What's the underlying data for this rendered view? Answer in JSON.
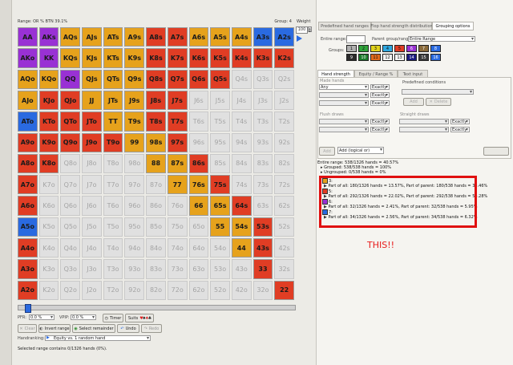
{
  "range_header": {
    "left": "Range: OR % BTN 39.1%",
    "group": "Group: 4",
    "weight_label": "Weight",
    "weight_value": "100"
  },
  "grid": {
    "rows": [
      [
        [
          "AA",
          "p"
        ],
        [
          "AKs",
          "p"
        ],
        [
          "AQs",
          "o"
        ],
        [
          "AJs",
          "o"
        ],
        [
          "ATs",
          "o"
        ],
        [
          "A9s",
          "o"
        ],
        [
          "A8s",
          "r"
        ],
        [
          "A7s",
          "r"
        ],
        [
          "A6s",
          "o"
        ],
        [
          "A5s",
          "o"
        ],
        [
          "A4s",
          "o"
        ],
        [
          "A3s",
          "b"
        ],
        [
          "A2s",
          "b"
        ]
      ],
      [
        [
          "AKo",
          "p"
        ],
        [
          "KK",
          "p"
        ],
        [
          "KQs",
          "o"
        ],
        [
          "KJs",
          "o"
        ],
        [
          "KTs",
          "o"
        ],
        [
          "K9s",
          "o"
        ],
        [
          "K8s",
          "r"
        ],
        [
          "K7s",
          "r"
        ],
        [
          "K6s",
          "r"
        ],
        [
          "K5s",
          "r"
        ],
        [
          "K4s",
          "r"
        ],
        [
          "K3s",
          "r"
        ],
        [
          "K2s",
          "r"
        ]
      ],
      [
        [
          "AQo",
          "o"
        ],
        [
          "KQo",
          "o"
        ],
        [
          "QQ",
          "p"
        ],
        [
          "QJs",
          "o"
        ],
        [
          "QTs",
          "o"
        ],
        [
          "Q9s",
          "o"
        ],
        [
          "Q8s",
          "r"
        ],
        [
          "Q7s",
          "r"
        ],
        [
          "Q6s",
          "r"
        ],
        [
          "Q5s",
          "r"
        ],
        [
          "Q4s",
          "g"
        ],
        [
          "Q3s",
          "g"
        ],
        [
          "Q2s",
          "g"
        ]
      ],
      [
        [
          "AJo",
          "o"
        ],
        [
          "KJo",
          "r"
        ],
        [
          "QJo",
          "r"
        ],
        [
          "JJ",
          "o"
        ],
        [
          "JTs",
          "o"
        ],
        [
          "J9s",
          "o"
        ],
        [
          "J8s",
          "r"
        ],
        [
          "J7s",
          "r"
        ],
        [
          "J6s",
          "g"
        ],
        [
          "J5s",
          "g"
        ],
        [
          "J4s",
          "g"
        ],
        [
          "J3s",
          "g"
        ],
        [
          "J2s",
          "g"
        ]
      ],
      [
        [
          "ATo",
          "b"
        ],
        [
          "KTo",
          "r"
        ],
        [
          "QTo",
          "r"
        ],
        [
          "JTo",
          "r"
        ],
        [
          "TT",
          "o"
        ],
        [
          "T9s",
          "o"
        ],
        [
          "T8s",
          "r"
        ],
        [
          "T7s",
          "r"
        ],
        [
          "T6s",
          "g"
        ],
        [
          "T5s",
          "g"
        ],
        [
          "T4s",
          "g"
        ],
        [
          "T3s",
          "g"
        ],
        [
          "T2s",
          "g"
        ]
      ],
      [
        [
          "A9o",
          "r"
        ],
        [
          "K9o",
          "r"
        ],
        [
          "Q9o",
          "r"
        ],
        [
          "J9o",
          "r"
        ],
        [
          "T9o",
          "r"
        ],
        [
          "99",
          "o"
        ],
        [
          "98s",
          "o"
        ],
        [
          "97s",
          "r"
        ],
        [
          "96s",
          "g"
        ],
        [
          "95s",
          "g"
        ],
        [
          "94s",
          "g"
        ],
        [
          "93s",
          "g"
        ],
        [
          "92s",
          "g"
        ]
      ],
      [
        [
          "A8o",
          "r"
        ],
        [
          "K8o",
          "r"
        ],
        [
          "Q8o",
          "g"
        ],
        [
          "J8o",
          "g"
        ],
        [
          "T8o",
          "g"
        ],
        [
          "98o",
          "g"
        ],
        [
          "88",
          "o"
        ],
        [
          "87s",
          "o"
        ],
        [
          "86s",
          "r"
        ],
        [
          "85s",
          "g"
        ],
        [
          "84s",
          "g"
        ],
        [
          "83s",
          "g"
        ],
        [
          "82s",
          "g"
        ]
      ],
      [
        [
          "A7o",
          "r"
        ],
        [
          "K7o",
          "g"
        ],
        [
          "Q7o",
          "g"
        ],
        [
          "J7o",
          "g"
        ],
        [
          "T7o",
          "g"
        ],
        [
          "97o",
          "g"
        ],
        [
          "87o",
          "g"
        ],
        [
          "77",
          "o"
        ],
        [
          "76s",
          "o"
        ],
        [
          "75s",
          "r"
        ],
        [
          "74s",
          "g"
        ],
        [
          "73s",
          "g"
        ],
        [
          "72s",
          "g"
        ]
      ],
      [
        [
          "A6o",
          "r"
        ],
        [
          "K6o",
          "g"
        ],
        [
          "Q6o",
          "g"
        ],
        [
          "J6o",
          "g"
        ],
        [
          "T6o",
          "g"
        ],
        [
          "96o",
          "g"
        ],
        [
          "86o",
          "g"
        ],
        [
          "76o",
          "g"
        ],
        [
          "66",
          "o"
        ],
        [
          "65s",
          "o"
        ],
        [
          "64s",
          "r"
        ],
        [
          "63s",
          "g"
        ],
        [
          "62s",
          "g"
        ]
      ],
      [
        [
          "A5o",
          "b"
        ],
        [
          "K5o",
          "g"
        ],
        [
          "Q5o",
          "g"
        ],
        [
          "J5o",
          "g"
        ],
        [
          "T5o",
          "g"
        ],
        [
          "95o",
          "g"
        ],
        [
          "85o",
          "g"
        ],
        [
          "75o",
          "g"
        ],
        [
          "65o",
          "g"
        ],
        [
          "55",
          "o"
        ],
        [
          "54s",
          "o"
        ],
        [
          "53s",
          "r"
        ],
        [
          "52s",
          "g"
        ]
      ],
      [
        [
          "A4o",
          "r"
        ],
        [
          "K4o",
          "g"
        ],
        [
          "Q4o",
          "g"
        ],
        [
          "J4o",
          "g"
        ],
        [
          "T4o",
          "g"
        ],
        [
          "94o",
          "g"
        ],
        [
          "84o",
          "g"
        ],
        [
          "74o",
          "g"
        ],
        [
          "64o",
          "g"
        ],
        [
          "54o",
          "g"
        ],
        [
          "44",
          "o"
        ],
        [
          "43s",
          "r"
        ],
        [
          "42s",
          "g"
        ]
      ],
      [
        [
          "A3o",
          "r"
        ],
        [
          "K3o",
          "g"
        ],
        [
          "Q3o",
          "g"
        ],
        [
          "J3o",
          "g"
        ],
        [
          "T3o",
          "g"
        ],
        [
          "93o",
          "g"
        ],
        [
          "83o",
          "g"
        ],
        [
          "73o",
          "g"
        ],
        [
          "63o",
          "g"
        ],
        [
          "53o",
          "g"
        ],
        [
          "43o",
          "g"
        ],
        [
          "33",
          "r"
        ],
        [
          "32s",
          "g"
        ]
      ],
      [
        [
          "A2o",
          "r"
        ],
        [
          "K2o",
          "g"
        ],
        [
          "Q2o",
          "g"
        ],
        [
          "J2o",
          "g"
        ],
        [
          "T2o",
          "g"
        ],
        [
          "92o",
          "g"
        ],
        [
          "82o",
          "g"
        ],
        [
          "72o",
          "g"
        ],
        [
          "62o",
          "g"
        ],
        [
          "52o",
          "g"
        ],
        [
          "42o",
          "g"
        ],
        [
          "32o",
          "g"
        ],
        [
          "22",
          "r"
        ]
      ]
    ]
  },
  "controls": {
    "pfr_label": "PFR:",
    "pfr_value": "0.0 %",
    "vpip_label": "VPIP:",
    "vpip_value": "0.0 %",
    "timer_label": "Timer",
    "suits_label": "Suits",
    "clear_label": "Clear",
    "invert_label": "Invert range",
    "select_remainder_label": "Select remainder",
    "undo_label": "Undo",
    "redo_label": "Redo",
    "handranking_label": "Handranking:",
    "handranking_value": "Equity vs. 1 random hand",
    "status_text": "Selected range contains 0/1326 hands (0%)."
  },
  "right": {
    "tabs": [
      "Predefined hand ranges",
      "Flop hand strength distribution",
      "Grouping options"
    ],
    "entire_range_label": "Entire range:",
    "parent_label": "Parent group/range:",
    "parent_value": "Entire Range",
    "groups_label": "Groups:",
    "group_buttons": [
      "1",
      "2",
      "3",
      "4",
      "5",
      "6",
      "7",
      "8",
      "9",
      "10",
      "11",
      "12",
      "13",
      "14",
      "15",
      "16"
    ],
    "group_colors": [
      "#b0b0b0",
      "#2fa33a",
      "#e0d21c",
      "#2fa8e0",
      "#e03d24",
      "#9931d4",
      "#8a6a3a",
      "#2a6ae0",
      "#2a2a2a",
      "#1a7a2a",
      "#e06a1a",
      "#f4f4f4",
      "#f4f4f4",
      "#1a1a80",
      "#3a3a3a",
      "#2a6ae0"
    ],
    "subtabs": [
      "Hand strength",
      "Equity / Range %",
      "Text input"
    ],
    "made_hands_label": "Made hands",
    "any_label": "Any",
    "exactly_label": "Exactly",
    "predefined_label": "Predefined conditions",
    "add_label": "Add",
    "delete_label": "Delete",
    "flush_draws_label": "Flush draws",
    "straight_draws_label": "Straight draws",
    "add_logical_label": "Add (logical or)"
  },
  "stats": {
    "entire": "Entire range: 538/1326 hands = 40.57%",
    "grouped": "Grouped: 538/538 hands = 100%",
    "ungrouped": "Ungrouped: 0/538 hands = 0%",
    "groups": [
      {
        "name": "3:",
        "text": "Part of all: 180/1326 hands = 13.57%, Part of parent: 180/538 hands = 33.46%",
        "color": "#e6a21c"
      },
      {
        "name": "5:",
        "text": "Part of all: 292/1326 hands = 22.02%, Part of parent: 292/538 hands = 54.28%",
        "color": "#e03d24"
      },
      {
        "name": "6:",
        "text": "Part of all: 32/1326 hands = 2.41%, Part of parent: 32/538 hands = 5.95%",
        "color": "#9931d4"
      },
      {
        "name": "7:",
        "text": "Part of all: 34/1326 hands = 2.56%, Part of parent: 34/538 hands = 6.32%",
        "color": "#2a6ae0"
      }
    ]
  },
  "annotation": "THIS!!"
}
